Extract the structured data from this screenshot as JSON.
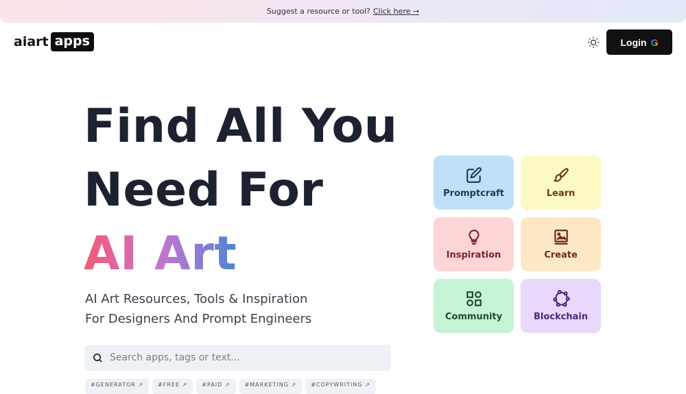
{
  "banner": {
    "text": "Suggest a resource or tool?",
    "link": "Click here →"
  },
  "header": {
    "logo_text": "aiart",
    "logo_box": "apps",
    "theme_icon": "sun-icon",
    "login_label": "Login",
    "login_icon": "G"
  },
  "hero": {
    "line1": "Find All You",
    "line2": "Need For",
    "line3": "AI Art",
    "subtitle_line1": "AI Art Resources, Tools & Inspiration",
    "subtitle_line2": "For Designers And Prompt Engineers"
  },
  "search": {
    "placeholder": "Search apps, tags or text..."
  },
  "tags": [
    "#GENERATOR ↗",
    "#FREE ↗",
    "#PAID ↗",
    "#MARKETING ↗",
    "#COPYWRITING ↗"
  ],
  "categories": [
    {
      "label": "Promptcraft",
      "icon": "edit-icon",
      "bg": "#bfe1f8",
      "fg": "#1f3a5c"
    },
    {
      "label": "Learn",
      "icon": "brush-icon",
      "bg": "#fdf9c3",
      "fg": "#6b3a17"
    },
    {
      "label": "Inspiration",
      "icon": "lightbulb-icon",
      "bg": "#fdd5d7",
      "fg": "#7c2131"
    },
    {
      "label": "Create",
      "icon": "image-book-icon",
      "bg": "#fde8c6",
      "fg": "#6b2d17"
    },
    {
      "label": "Community",
      "icon": "shapes-icon",
      "bg": "#c7f3d6",
      "fg": "#1d4a33"
    },
    {
      "label": "Blockchain",
      "icon": "network-icon",
      "bg": "#e8d8fb",
      "fg": "#4a2a78"
    }
  ]
}
